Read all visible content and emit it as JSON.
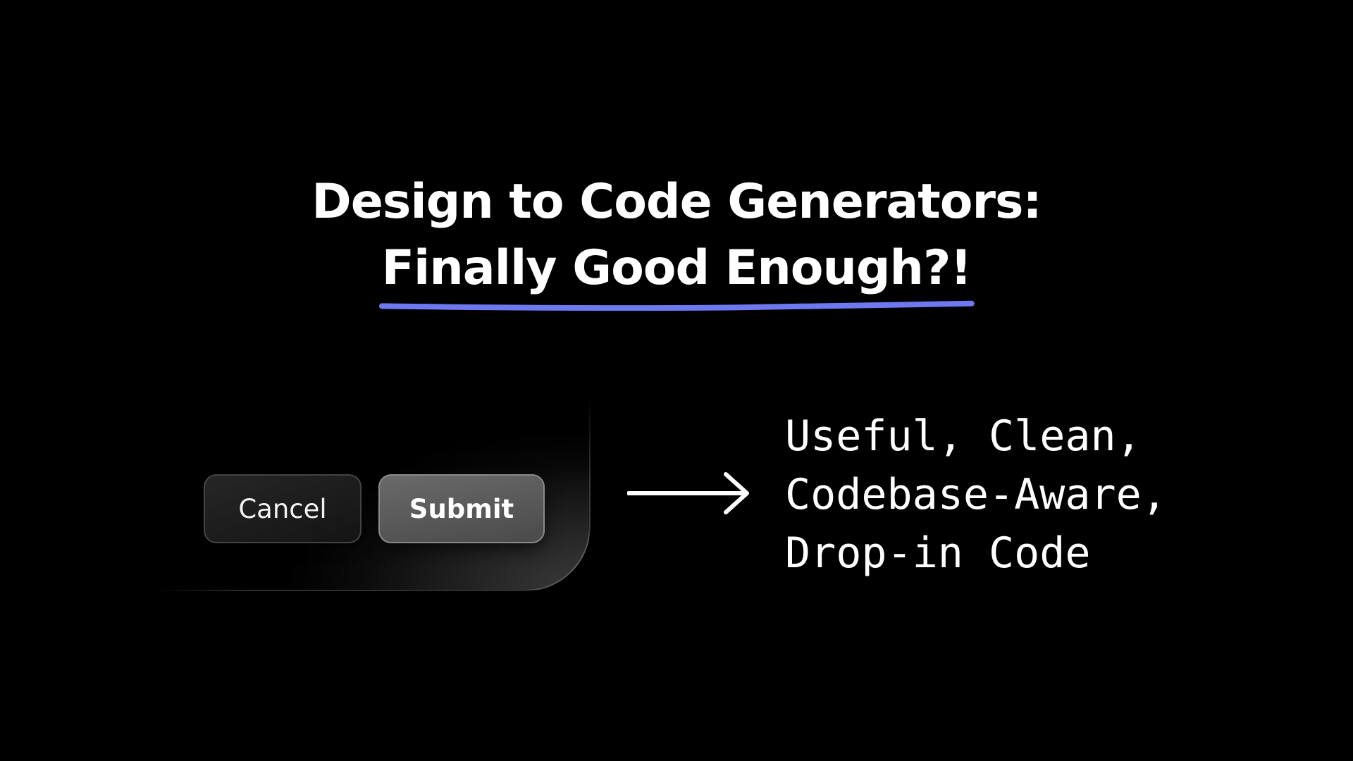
{
  "headline": {
    "line1": "Design to Code Generators:",
    "line2": "Finally Good Enough?!",
    "underline_color": "#6E78F0"
  },
  "demo": {
    "cancel_label": "Cancel",
    "submit_label": "Submit"
  },
  "arrow_icon": "right-arrow-icon",
  "features": [
    "Useful, Clean,",
    "Codebase-Aware,",
    "Drop-in Code"
  ],
  "colors": {
    "background": "#000000",
    "text": "#FFFFFF",
    "accent": "#6E78F0"
  }
}
